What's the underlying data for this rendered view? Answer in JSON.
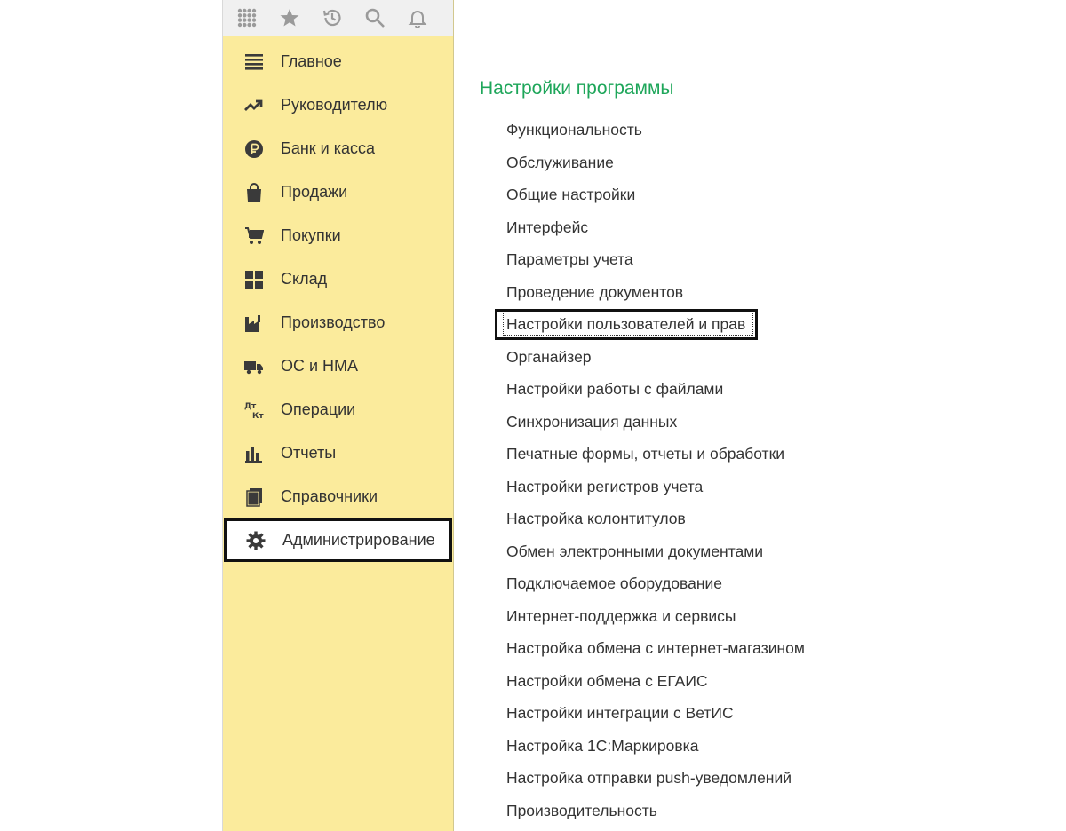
{
  "colors": {
    "sidebar_bg": "#fbeb9c",
    "toolbar_bg": "#f0f0f0",
    "title_green": "#1ea65a",
    "icon_gray": "#9a9a9a",
    "nav_icon_dark": "#3a3a3a",
    "highlight_border": "#111111"
  },
  "toolbar": {
    "icons": [
      "apps-grid-icon",
      "star-icon",
      "history-icon",
      "search-icon",
      "bell-icon"
    ]
  },
  "sidebar": {
    "items": [
      {
        "label": "Главное",
        "icon": "menu-lines-icon"
      },
      {
        "label": "Руководителю",
        "icon": "trend-icon"
      },
      {
        "label": "Банк и касса",
        "icon": "ruble-icon"
      },
      {
        "label": "Продажи",
        "icon": "shopping-bag-icon"
      },
      {
        "label": "Покупки",
        "icon": "cart-icon"
      },
      {
        "label": "Склад",
        "icon": "warehouse-icon"
      },
      {
        "label": "Производство",
        "icon": "factory-icon"
      },
      {
        "label": "ОС и НМА",
        "icon": "truck-icon"
      },
      {
        "label": "Операции",
        "icon": "dt-kt-icon"
      },
      {
        "label": "Отчеты",
        "icon": "bar-chart-icon"
      },
      {
        "label": "Справочники",
        "icon": "books-icon"
      },
      {
        "label": "Администрирование",
        "icon": "gear-icon",
        "highlighted": true
      }
    ]
  },
  "main": {
    "title": "Настройки программы",
    "items": [
      "Функциональность",
      "Обслуживание",
      "Общие настройки",
      "Интерфейс",
      "Параметры учета",
      "Проведение документов",
      "Настройки пользователей и прав",
      "Органайзер",
      "Настройки работы с файлами",
      "Синхронизация данных",
      "Печатные формы, отчеты и обработки",
      "Настройки регистров учета",
      "Настройка колонтитулов",
      "Обмен электронными документами",
      "Подключаемое оборудование",
      "Интернет-поддержка и сервисы",
      "Настройка обмена с интернет-магазином",
      "Настройки обмена с ЕГАИС",
      "Настройки интеграции с ВетИС",
      "Настройка 1С:Маркировка",
      "Настройка отправки push-уведомлений",
      "Производительность"
    ],
    "highlighted_index": 6
  }
}
